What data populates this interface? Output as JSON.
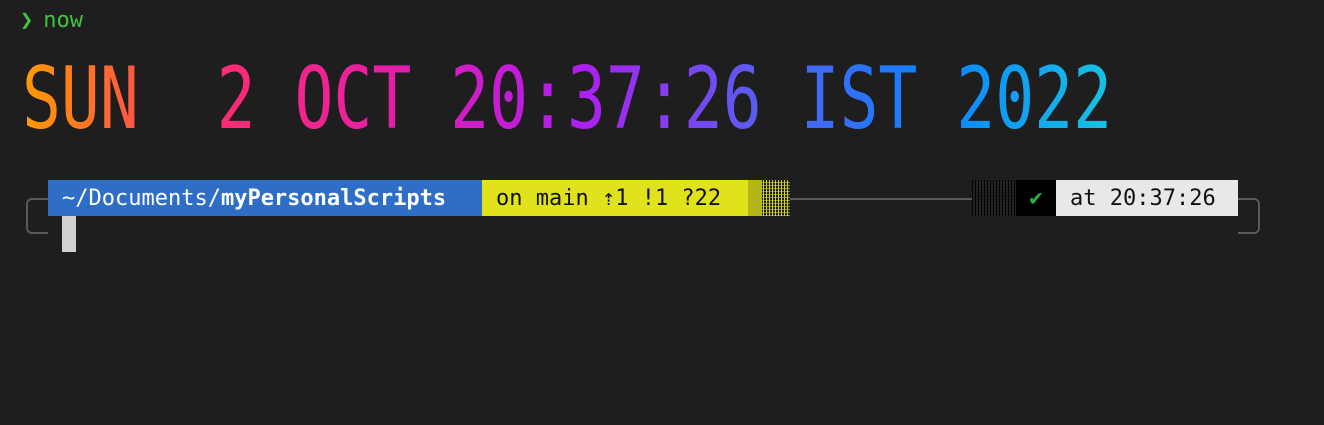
{
  "command": {
    "prompt_symbol": "❯",
    "text": "now"
  },
  "clock": {
    "text": "SUN  2 OCT 20:37:26 IST 2022",
    "gradient_colors": [
      "#ff9b00",
      "#ff2d6f",
      "#e41ea7",
      "#b21cf0",
      "#5b5cf0",
      "#0a84ff",
      "#19c6e0"
    ]
  },
  "prompt": {
    "path_prefix": "~/Documents/",
    "path_current": "myPersonalScripts",
    "git_status": "on main ⇡1 !1 ?22",
    "status_icon": "✔",
    "time_label": "at 20:37:26"
  },
  "colors": {
    "background": "#1e1e1e",
    "path_segment": "#2f6ec7",
    "git_segment": "#e0e31b",
    "status_segment": "#000000",
    "time_segment": "#e8e8e8",
    "command_green": "#3ec43e",
    "check_green": "#27b54a"
  }
}
